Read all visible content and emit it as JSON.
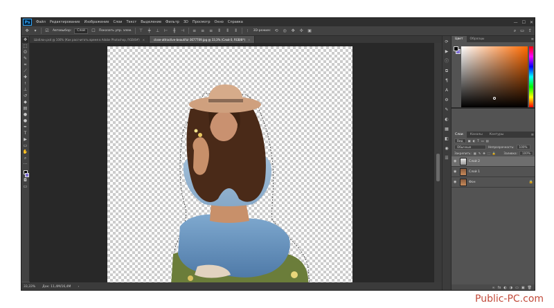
{
  "menubar": {
    "logo": "Ps",
    "items": [
      "Файл",
      "Редактирование",
      "Изображение",
      "Слои",
      "Текст",
      "Выделение",
      "Фильтр",
      "3D",
      "Просмотр",
      "Окно",
      "Справка"
    ],
    "controls": [
      "—",
      "☐",
      "✕"
    ]
  },
  "options": {
    "autoselect_label": "Автовыбор:",
    "autoselect_value": "Слой",
    "transform_label": "Показать упр. элем.",
    "mode_label": "3D-режим:"
  },
  "tabs": [
    {
      "label": "Шаблон.psd @ 100% (Как рассчитать время в Adobe Photoshop, RGB/8#)",
      "close": "×"
    },
    {
      "label": "close-attractive-beautiful-3677709.jpg @ 33,3% (Слой 0, RGB/8*)",
      "close": "×"
    }
  ],
  "status": {
    "zoom": "33,33%",
    "doc_size": "Док: 11,4М/16,4М",
    "arrow": "›"
  },
  "color_panel": {
    "tabs": [
      "Цвет",
      "Образцы"
    ],
    "menu": "≡",
    "fg_color": "#000000",
    "bg_color": "#7f6fd6",
    "picker": {
      "saturation": 0.5,
      "brightness": 0.15
    }
  },
  "layers_panel": {
    "tabs": [
      "Слои",
      "Каналы",
      "Контуры"
    ],
    "menu": "≡",
    "kind_label": "Вид",
    "blend_mode": "Обычные",
    "opacity_label": "Непрозрачность:",
    "opacity_value": "100%",
    "lock_label": "Закрепить:",
    "fill_label": "Заливка:",
    "fill_value": "100%",
    "layers": [
      {
        "name": "Слой 2",
        "selected": true,
        "locked": false
      },
      {
        "name": "Слой 1",
        "selected": false,
        "locked": false
      },
      {
        "name": "Фон",
        "selected": false,
        "locked": true
      }
    ],
    "footer_icons": [
      "∞",
      "fx",
      "◐",
      "◑",
      "▭",
      "▣",
      "🗑"
    ]
  },
  "watermark": "Public-PC.com"
}
